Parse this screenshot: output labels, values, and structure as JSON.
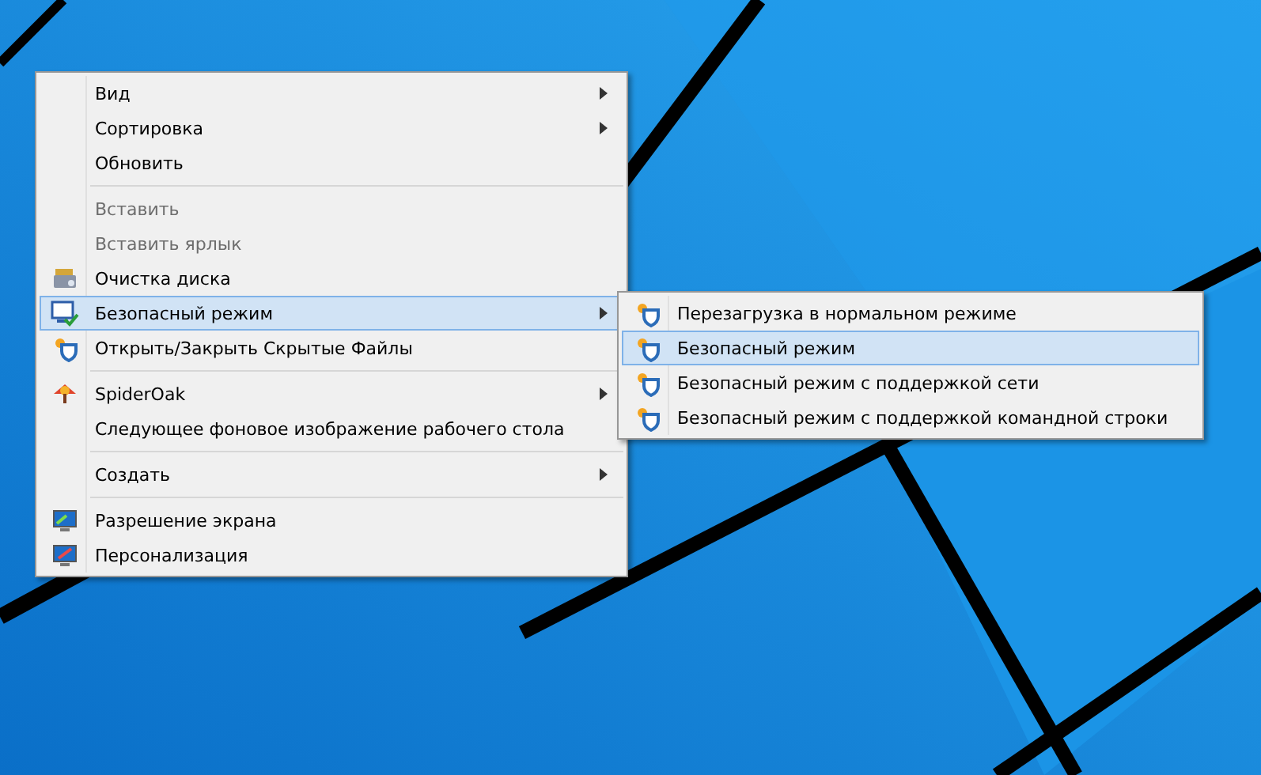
{
  "context_menu": {
    "items": [
      {
        "kind": "plain",
        "label": "Вид",
        "submenu": true,
        "disabled": false,
        "selected": false
      },
      {
        "kind": "plain",
        "label": "Сортировка",
        "submenu": true,
        "disabled": false,
        "selected": false
      },
      {
        "kind": "plain",
        "label": "Обновить",
        "submenu": false,
        "disabled": false,
        "selected": false
      },
      {
        "kind": "separator"
      },
      {
        "kind": "plain",
        "label": "Вставить",
        "submenu": false,
        "disabled": true,
        "selected": false
      },
      {
        "kind": "plain",
        "label": "Вставить ярлык",
        "submenu": false,
        "disabled": true,
        "selected": false
      },
      {
        "kind": "drive",
        "label": "Очистка диска",
        "submenu": false,
        "disabled": false,
        "selected": false
      },
      {
        "kind": "checkmonitor",
        "label": "Безопасный режим",
        "submenu": true,
        "disabled": false,
        "selected": true
      },
      {
        "kind": "shield",
        "label": "Открыть/Закрыть Скрытые Файлы",
        "submenu": false,
        "disabled": false,
        "selected": false
      },
      {
        "kind": "separator"
      },
      {
        "kind": "tree",
        "label": "SpiderOak",
        "submenu": true,
        "disabled": false,
        "selected": false
      },
      {
        "kind": "plain",
        "label": "Следующее фоновое изображение рабочего стола",
        "submenu": false,
        "disabled": false,
        "selected": false
      },
      {
        "kind": "separator"
      },
      {
        "kind": "plain",
        "label": "Создать",
        "submenu": true,
        "disabled": false,
        "selected": false
      },
      {
        "kind": "separator"
      },
      {
        "kind": "monitor",
        "label": "Разрешение экрана",
        "submenu": false,
        "disabled": false,
        "selected": false
      },
      {
        "kind": "brushmonitor",
        "label": "Персонализация",
        "submenu": false,
        "disabled": false,
        "selected": false
      }
    ]
  },
  "submenu": {
    "items": [
      {
        "kind": "shield",
        "label": "Перезагрузка в нормальном режиме",
        "submenu": false,
        "disabled": false,
        "selected": false
      },
      {
        "kind": "shield",
        "label": "Безопасный режим",
        "submenu": false,
        "disabled": false,
        "selected": true
      },
      {
        "kind": "shield",
        "label": "Безопасный режим с поддержкой сети",
        "submenu": false,
        "disabled": false,
        "selected": false
      },
      {
        "kind": "shield",
        "label": "Безопасный режим с поддержкой командной строки",
        "submenu": false,
        "disabled": false,
        "selected": false
      }
    ]
  }
}
